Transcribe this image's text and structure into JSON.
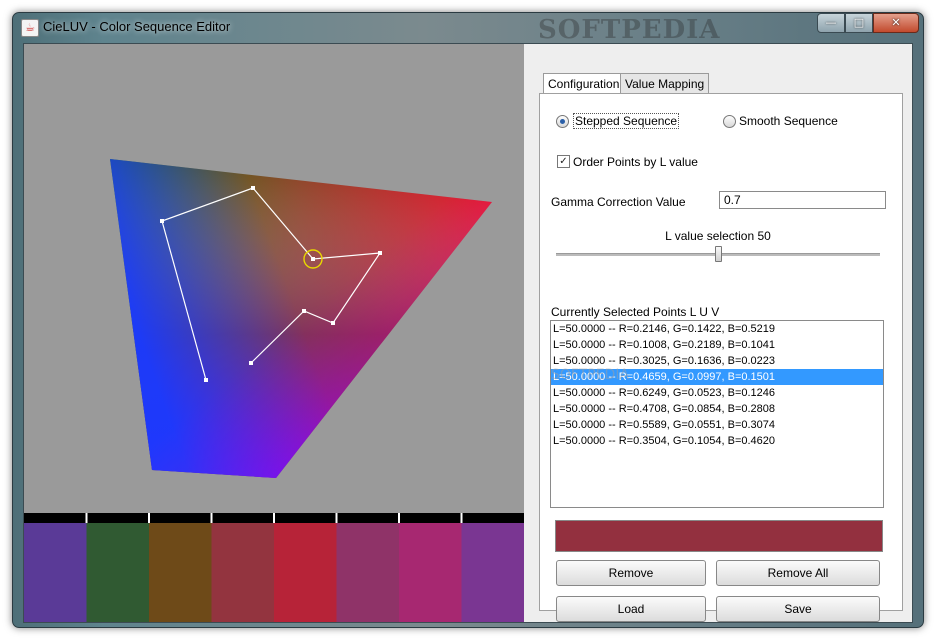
{
  "window": {
    "title": "CieLUV - Color Sequence Editor",
    "watermark": "SOFTPEDIA",
    "controls": {
      "minimize": "—",
      "maximize": "□",
      "close": "✕"
    }
  },
  "tabs": [
    {
      "label": "Configuration",
      "active": true
    },
    {
      "label": "Value Mapping",
      "active": false
    }
  ],
  "config": {
    "stepped_label": "Stepped Sequence",
    "smooth_label": "Smooth Sequence",
    "selected_mode": "stepped",
    "order_label": "Order Points by L value",
    "order_checked": true,
    "gamma_label": "Gamma Correction Value",
    "gamma_value": "0.7",
    "l_slider_label": "L value selection 50",
    "l_value": 50,
    "points_label": "Currently Selected Points L U V"
  },
  "points": [
    "L=50.0000 -- R=0.2146, G=0.1422, B=0.5219",
    "L=50.0000 -- R=0.1008, G=0.2189, B=0.1041",
    "L=50.0000 -- R=0.3025, G=0.1636, B=0.0223",
    "L=50.0000 -- R=0.4659, G=0.0997, B=0.1501",
    "L=50.0000 -- R=0.6249, G=0.0523, B=0.1246",
    "L=50.0000 -- R=0.4708, G=0.0854, B=0.2808",
    "L=50.0000 -- R=0.5589, G=0.0551, B=0.3074",
    "L=50.0000 -- R=0.3504, G=0.1054, B=0.4620"
  ],
  "selected_index": 3,
  "buttons": {
    "remove": "Remove",
    "remove_all": "Remove All",
    "load": "Load",
    "save": "Save"
  },
  "colors": {
    "preview": "#93303f",
    "selection": "#3399ff",
    "swatches": [
      "#5a3a97",
      "#305a32",
      "#6e4a18",
      "#93343f",
      "#b72338",
      "#8f3368",
      "#a72871",
      "#7a3692"
    ]
  }
}
